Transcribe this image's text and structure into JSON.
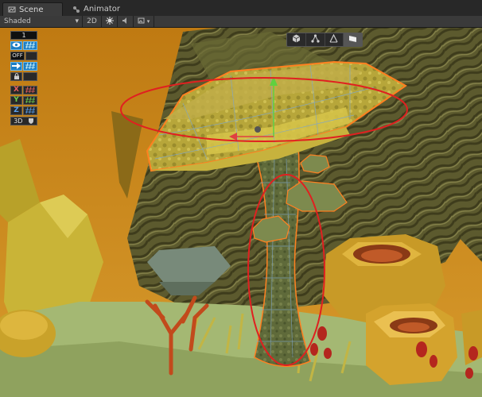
{
  "tabs": [
    {
      "label": "Scene",
      "icon": "scene-icon",
      "active": true
    },
    {
      "label": "Animator",
      "icon": "animator-icon",
      "active": false
    }
  ],
  "toolbar": {
    "shading_mode": "Shaded",
    "mode_2d": "2D",
    "icons": [
      "lighting-toggle-icon",
      "image-effects-toggle-icon"
    ]
  },
  "left_panel": {
    "layer_number": "1",
    "visibility_icon": "eye-icon",
    "visibility_grid_icon": "grid-icon",
    "off_label": "OFF",
    "snap_icon": "arrow-right-icon",
    "lock_icon": "lock-icon",
    "x_label": "X",
    "y_label": "Y",
    "z_label": "Z",
    "view3d_label": "3D"
  },
  "gizmo_tools": [
    "cube-icon",
    "hierarchy-icon",
    "transform-icon",
    "shape-icon"
  ],
  "colors": {
    "accent_blue": "#1d7ec4",
    "axis_x": "#e04040",
    "axis_y": "#60d040",
    "axis_z": "#4090f0",
    "selection_outline": "#ff8020",
    "annotation_ellipse": "#e02020"
  }
}
